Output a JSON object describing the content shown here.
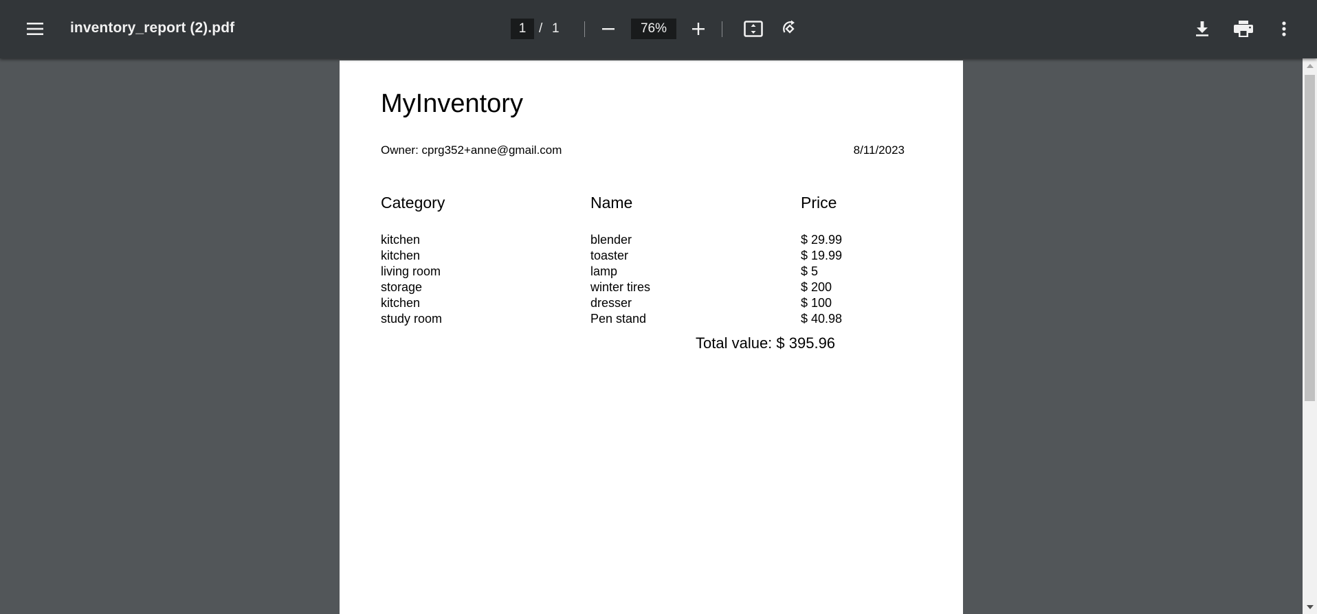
{
  "toolbar": {
    "filename": "inventory_report (2).pdf",
    "current_page": "1",
    "page_separator": "/",
    "total_pages": "1",
    "zoom": "76%"
  },
  "icons": {
    "menu": "menu-icon",
    "zoom_out": "minus-icon",
    "zoom_in": "plus-icon",
    "fit": "fit-to-page-icon",
    "rotate": "rotate-icon",
    "download": "download-icon",
    "print": "print-icon",
    "more": "more-vertical-icon"
  },
  "document": {
    "title": "MyInventory",
    "owner": "Owner: cprg352+anne@gmail.com",
    "date": "8/11/2023",
    "headers": {
      "category": "Category",
      "name": "Name",
      "price": "Price"
    },
    "rows": [
      {
        "category": "kitchen",
        "name": "blender",
        "price": "$ 29.99"
      },
      {
        "category": "kitchen",
        "name": "toaster",
        "price": "$ 19.99"
      },
      {
        "category": "living room",
        "name": "lamp",
        "price": "$ 5"
      },
      {
        "category": "storage",
        "name": "winter tires",
        "price": "$ 200"
      },
      {
        "category": "kitchen",
        "name": "dresser",
        "price": "$ 100"
      },
      {
        "category": "study room",
        "name": "Pen stand",
        "price": "$ 40.98"
      }
    ],
    "total": "Total value: $ 395.96"
  },
  "colors": {
    "toolbar_bg": "#323639",
    "viewer_bg": "#525659",
    "page_bg": "#ffffff"
  }
}
